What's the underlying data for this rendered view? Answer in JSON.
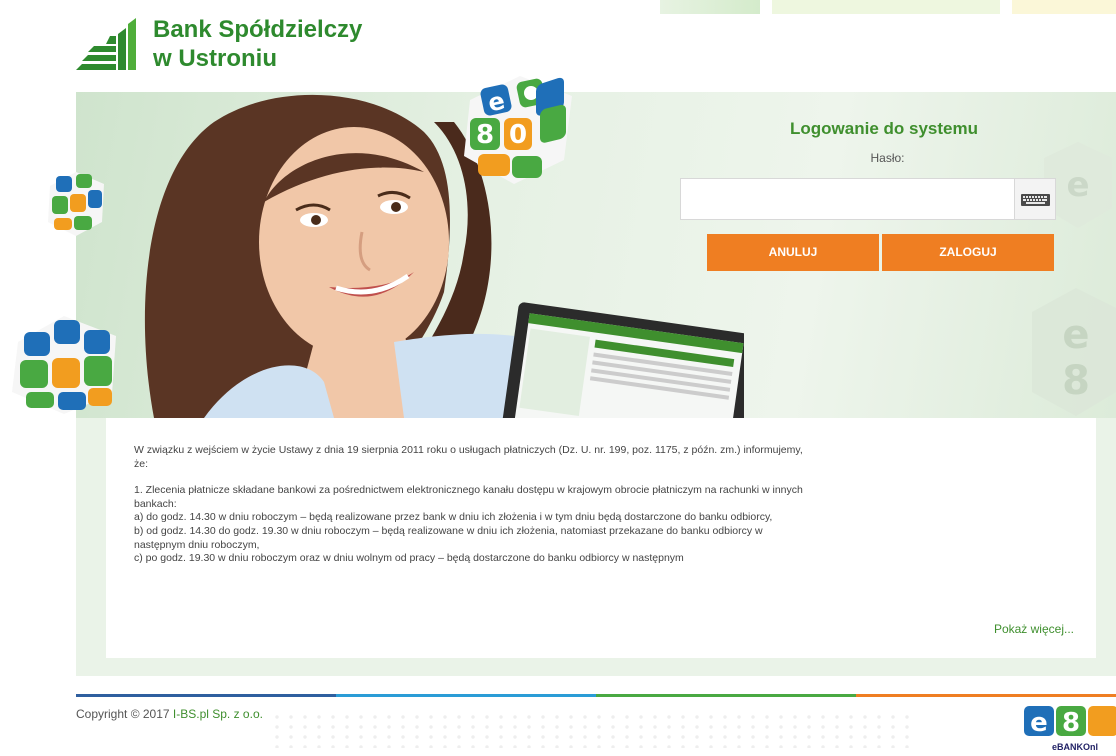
{
  "bank": {
    "name_line1": "Bank Spółdzielczy",
    "name_line2": "w Ustroniu"
  },
  "login": {
    "title": "Logowanie do systemu",
    "password_label": "Hasło:",
    "password_value": "",
    "keyboard_icon": "virtual-keyboard-icon",
    "cancel_label": "ANULUJ",
    "login_label": "ZALOGUJ"
  },
  "info": {
    "paragraph1": "W związku z wejściem w życie Ustawy z dnia 19 sierpnia 2011 roku o usługach płatniczych (Dz. U. nr. 199, poz. 1175, z późn. zm.) informujemy, że:",
    "item1": "1. Zlecenia płatnicze składane bankowi za pośrednictwem elektronicznego kanału dostępu w krajowym obrocie płatniczym na rachunki w innych bankach:",
    "item_a": "a) do godz. 14.30 w dniu roboczym – będą realizowane przez bank w dniu ich złożenia i w tym dniu będą dostarczone do banku odbiorcy,",
    "item_b": "b) od godz. 14.30 do godz. 19.30 w dniu roboczym – będą realizowane w dniu ich złożenia, natomiast przekazane do banku odbiorcy  w następnym dniu roboczym,",
    "item_c": "c) po godz. 19.30 w dniu roboczym oraz w dniu wolnym od pracy – będą dostarczone do banku odbiorcy w następnym",
    "show_more": "Pokaż więcej..."
  },
  "footer": {
    "copyright_prefix": "Copyright © 2017",
    "company": "I-BS.pl Sp. z o.o.",
    "ebank_caption": "eBANKOnl"
  },
  "colors": {
    "brand_green": "#2e8a2e",
    "accent_orange": "#ef7e22",
    "link_green": "#3f8f2e"
  }
}
